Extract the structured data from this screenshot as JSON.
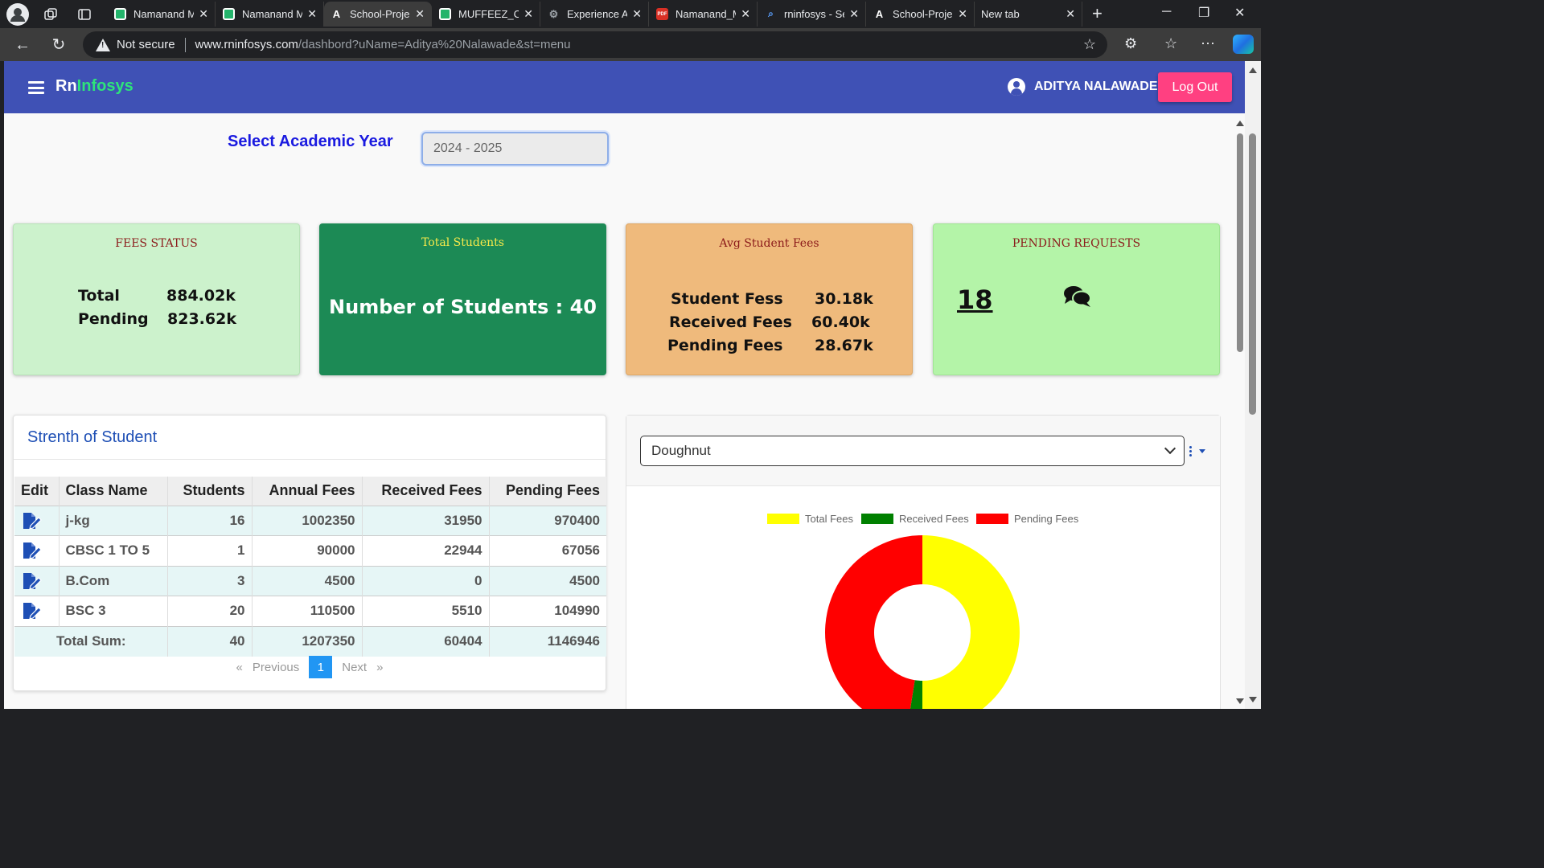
{
  "browser": {
    "tabs": [
      {
        "title": "Namanand M",
        "favicon": "green"
      },
      {
        "title": "Namanand M",
        "favicon": "green"
      },
      {
        "title": "School-Proje",
        "favicon": "a",
        "active": true
      },
      {
        "title": "MUFFEEZ_CV",
        "favicon": "green"
      },
      {
        "title": "Experience A",
        "favicon": "gear"
      },
      {
        "title": "Namanand_M",
        "favicon": "pdf"
      },
      {
        "title": "rninfosys - Se",
        "favicon": "search"
      },
      {
        "title": "School-Proje",
        "favicon": "a"
      },
      {
        "title": "New tab",
        "favicon": "page"
      }
    ],
    "security": "Not secure",
    "url_host": "www.rninfosys.com",
    "url_rest": "/dashbord?uName=Aditya%20Nalawade&st=menu"
  },
  "navbar": {
    "brand_rn": "Rn",
    "brand_infosys": "Infosys",
    "username": "ADITYA NALAWADE",
    "logout_label": "Log Out"
  },
  "academic": {
    "label": "Select Academic Year",
    "value": "2024 - 2025"
  },
  "cards": {
    "fees_status": {
      "title": "FEES STATUS",
      "total_label": "Total",
      "total_value": "884.02k",
      "pending_label": "Pending",
      "pending_value": "823.62k"
    },
    "total_students": {
      "title": "Total Students",
      "text": "Number of Students : 40"
    },
    "avg_fees": {
      "title": "Avg Student Fees",
      "student_label": "Student Fess",
      "student_value": "30.18k",
      "received_label": "Received Fees",
      "received_value": "60.40k",
      "pending_label": "Pending Fees",
      "pending_value": "28.67k"
    },
    "pending_requests": {
      "title": "PENDING REQUESTS",
      "count": "18"
    }
  },
  "strength": {
    "title": "Strenth of Student",
    "headers": [
      "Edit",
      "Class Name",
      "Students",
      "Annual Fees",
      "Received Fees",
      "Pending Fees"
    ],
    "rows": [
      {
        "class": "j-kg",
        "students": "16",
        "annual": "1002350",
        "received": "31950",
        "pending": "970400"
      },
      {
        "class": "CBSC 1 TO 5",
        "students": "1",
        "annual": "90000",
        "received": "22944",
        "pending": "67056"
      },
      {
        "class": "B.Com",
        "students": "3",
        "annual": "4500",
        "received": "0",
        "pending": "4500"
      },
      {
        "class": "BSC 3",
        "students": "20",
        "annual": "110500",
        "received": "5510",
        "pending": "104990"
      }
    ],
    "total": {
      "label": "Total Sum:",
      "students": "40",
      "annual": "1207350",
      "received": "60404",
      "pending": "1146946"
    },
    "pager": {
      "prev": "Previous",
      "page": "1",
      "next": "Next",
      "first_glyph": "«",
      "last_glyph": "»"
    }
  },
  "chart_panel": {
    "select_value": "Doughnut"
  },
  "chart_data": {
    "type": "doughnut",
    "categories": [
      "Total Fees",
      "Received Fees",
      "Pending Fees"
    ],
    "values": [
      1207350,
      60404,
      1146946
    ],
    "colors": [
      "#ffff00",
      "#008000",
      "#ff0000"
    ],
    "legend": "top"
  }
}
